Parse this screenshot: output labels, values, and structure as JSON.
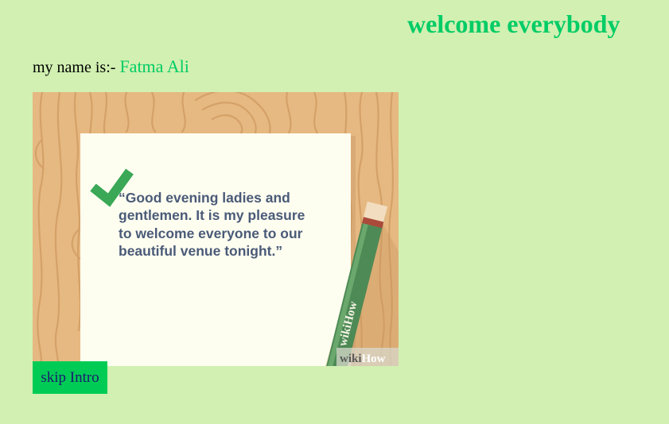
{
  "header": {
    "title": "welcome everybody"
  },
  "intro": {
    "name_label": "my name is:-",
    "name_value": "Fatma Ali"
  },
  "image": {
    "quote_lines": [
      "“Good evening ladies and",
      "gentlemen. It is my pleasure",
      "to welcome everyone to our",
      "beautiful venue tonight.”"
    ],
    "pen_text": "wikiHow",
    "watermark_wiki": "wiki",
    "watermark_how": "How"
  },
  "actions": {
    "skip_label": "skip Intro"
  },
  "colors": {
    "page_background": "#d1f0b1",
    "accent_green": "#00cc66",
    "button_background": "#00cc55",
    "button_text": "#1c1c6e"
  }
}
